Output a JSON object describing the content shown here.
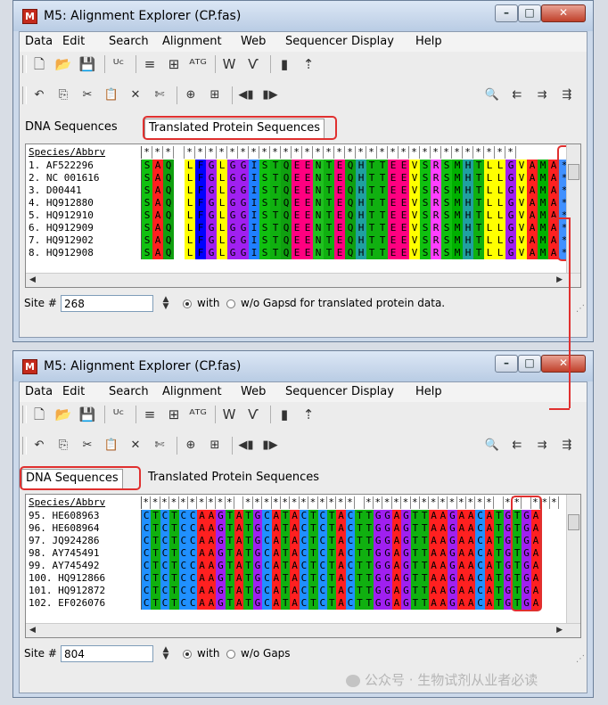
{
  "windows": [
    {
      "title": "M5: Alignment Explorer (CP.fas)",
      "menu": [
        "Data",
        "Edit",
        "Search",
        "Alignment",
        "Web",
        "Sequencer",
        "Display",
        "Help"
      ],
      "tabs": [
        "DNA Sequences",
        "Translated Protein Sequences"
      ],
      "active_tab": 1,
      "header_name": "Species/Abbrv",
      "header_stars": "*** *******************************",
      "rows": [
        {
          "name": "1. AF522296",
          "seq": "SAQ LFGLGGISTQEENTEQHTTEEVSRSMHTLLGVAMA*"
        },
        {
          "name": "2. NC 001616",
          "seq": "SAQ LFGLGGISTQEENTEQHTTEEVSRSMHTLLGVAMA*"
        },
        {
          "name": "3. D00441",
          "seq": "SAQ LFGLGGISTQEENTEQHTTEEVSRSMHTLLGVAMA*"
        },
        {
          "name": "4. HQ912880",
          "seq": "SAQ LFGLGGISTQEENTEQHTTEEVSRSMHTLLGVAMA*"
        },
        {
          "name": "5. HQ912910",
          "seq": "SAQ LFGLGGISTQEENTEQHTTEEVSRSMHTLLGVAMA*"
        },
        {
          "name": "6. HQ912909",
          "seq": "SAQ LFGLGGISTQEENTEQHTTEEVSRSMHTLLGVAMA*"
        },
        {
          "name": "7. HQ912902",
          "seq": "SAQ LFGLGGISTQEENTEQHTTEEVSRSMHTLLGVAMA*"
        },
        {
          "name": "8. HQ912908",
          "seq": "SAQ LFGLGGISTQEENTEQHTTEEVSRSMHTLLGVAMA*"
        }
      ],
      "site_label": "Site #",
      "site_value": "268",
      "with_label": "with",
      "wo_label": "w/o Gaps",
      "status_note": "d for translated protein data."
    },
    {
      "title": "M5: Alignment Explorer (CP.fas)",
      "menu": [
        "Data",
        "Edit",
        "Search",
        "Alignment",
        "Web",
        "Sequencer",
        "Display",
        "Help"
      ],
      "tabs": [
        "DNA Sequences",
        "Translated Protein Sequences"
      ],
      "active_tab": 0,
      "header_name": "Species/Abbrv",
      "header_stars": "********** ************ ************** ** ***",
      "rows": [
        {
          "name": "95. HE608963",
          "seq": "CTCTCCAAGTATGCATACTCTACTTGGAGTTAAGAACATGTGA"
        },
        {
          "name": "96. HE608964",
          "seq": "CTCTCCAAGTATGCATACTCTACTTGGAGTTAAGAACATGTGA"
        },
        {
          "name": "97. JQ924286",
          "seq": "CTCTCCAAGTATGCATACTCTACTTGGAGTTAAGAACATGTGA"
        },
        {
          "name": "98. AY745491",
          "seq": "CTCTCCAAGTATGCATACTCTACTTGGAGTTAAGAACATGTGA"
        },
        {
          "name": "99. AY745492",
          "seq": "CTCTCCAAGTATGCATACTCTACTTGGAGTTAAGAACATGTGA"
        },
        {
          "name": "100. HQ912866",
          "seq": "CTCTCCAAGTATGCATACTCTACTTGGAGTTAAGAACATGTGA"
        },
        {
          "name": "101. HQ912872",
          "seq": "CTCTCCAAGTATGCATACTCTACTTGGAGTTAAGAACATGTGA"
        },
        {
          "name": "102. EF026076",
          "seq": "CTCTCCAAGTATGCATACTCTACTTGGAGTTAAGAACATGTGA"
        }
      ],
      "site_label": "Site #",
      "site_value": "804",
      "with_label": "with",
      "wo_label": "w/o Gaps",
      "status_note": ""
    }
  ],
  "watermark": "公众号 · 生物试剂从业者必读",
  "colors": {
    "highlight": "#e0302f",
    "A": "#ff2020",
    "C": "#2090ff",
    "G": "#a020f0",
    "T": "#10b010",
    "S": "#10c010",
    "Q": "#10a010",
    "L": "#ffff00",
    "F": "#0000ff",
    "I": "#2080ff",
    "E": "#ff0080",
    "N": "#20c020",
    "H": "#20a0a0",
    "V": "#ffff00",
    "R": "#ff40ff",
    "M": "#00b000",
    "stop": "#4090ff"
  }
}
